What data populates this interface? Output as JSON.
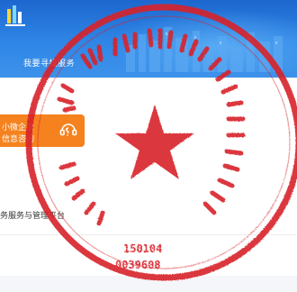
{
  "header": {
    "title": "我要寻找服务"
  },
  "card": {
    "line1": "小微企业",
    "line2": "信息咨询",
    "icon": "headset-icon"
  },
  "services": {
    "link_text": "务服务与管理平台"
  },
  "stamp": {
    "code_line1": "150104",
    "code_line2": "0039608",
    "color": "#d8232a"
  },
  "colors": {
    "header_blue": "#2f86e6",
    "accent_orange": "#f5821f"
  }
}
